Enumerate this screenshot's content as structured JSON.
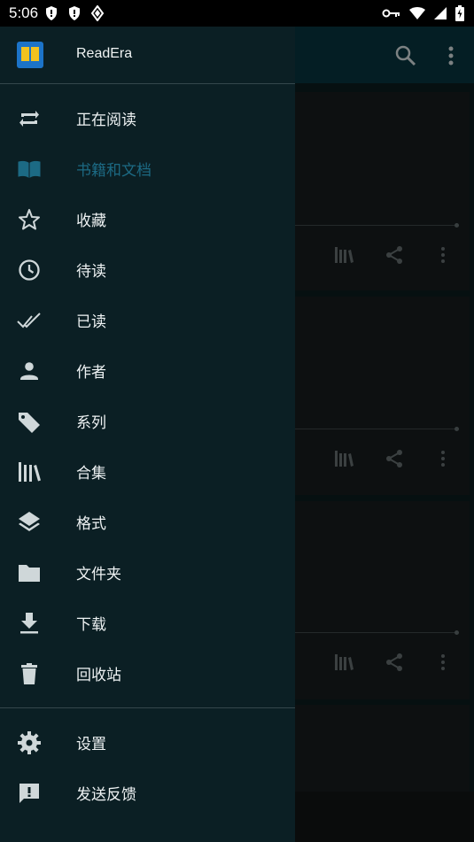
{
  "status": {
    "time": "5:06"
  },
  "drawer": {
    "app_title": "ReadEra",
    "items": [
      {
        "label": "正在阅读",
        "icon": "repeat-icon"
      },
      {
        "label": "书籍和文档",
        "icon": "book-open-icon",
        "active": true
      },
      {
        "label": "收藏",
        "icon": "star-outline-icon"
      },
      {
        "label": "待读",
        "icon": "clock-icon"
      },
      {
        "label": "已读",
        "icon": "double-check-icon"
      },
      {
        "label": "作者",
        "icon": "person-icon"
      },
      {
        "label": "系列",
        "icon": "tag-icon"
      },
      {
        "label": "合集",
        "icon": "library-icon"
      },
      {
        "label": "格式",
        "icon": "layers-icon"
      },
      {
        "label": "文件夹",
        "icon": "folder-icon"
      },
      {
        "label": "下载",
        "icon": "download-icon"
      },
      {
        "label": "回收站",
        "icon": "trash-icon"
      }
    ],
    "bottom_items": [
      {
        "label": "设置",
        "icon": "gear-icon"
      },
      {
        "label": "发送反馈",
        "icon": "feedback-icon"
      }
    ]
  },
  "colors": {
    "drawer_bg": "#0b1f24",
    "active": "#1c6a84",
    "toolbar": "#07313a"
  }
}
